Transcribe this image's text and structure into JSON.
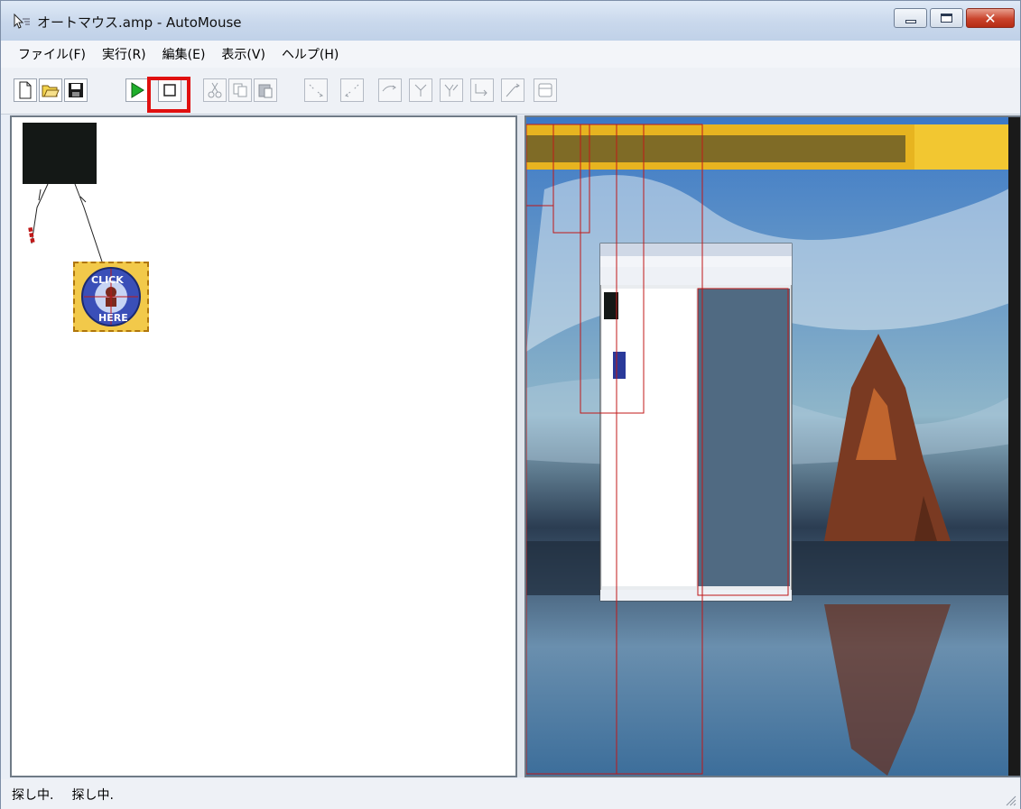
{
  "window": {
    "title": "オートマウス.amp - AutoMouse",
    "controls": [
      "minimize-icon",
      "maximize-icon",
      "close-icon"
    ]
  },
  "menu": {
    "items": [
      "ファイル(F)",
      "実行(R)",
      "編集(E)",
      "表示(V)",
      "ヘルプ(H)"
    ]
  },
  "toolbar": {
    "buttons": [
      {
        "icon": "new-file-icon",
        "enabled": true
      },
      {
        "icon": "open-folder-icon",
        "enabled": true
      },
      {
        "icon": "save-icon",
        "enabled": true
      },
      {
        "icon": "run-icon",
        "enabled": true
      },
      {
        "icon": "stop-icon",
        "enabled": true,
        "highlighted": true
      },
      {
        "icon": "cut-icon",
        "enabled": false
      },
      {
        "icon": "copy-icon",
        "enabled": false
      },
      {
        "icon": "paste-icon",
        "enabled": false
      },
      {
        "icon": "step-in-icon",
        "enabled": false
      },
      {
        "icon": "step-out-icon",
        "enabled": false
      },
      {
        "icon": "branch-1-icon",
        "enabled": false
      },
      {
        "icon": "branch-2-icon",
        "enabled": false
      },
      {
        "icon": "branch-3-icon",
        "enabled": false
      },
      {
        "icon": "branch-4-icon",
        "enabled": false
      },
      {
        "icon": "branch-5-icon",
        "enabled": false
      },
      {
        "icon": "window-icon",
        "enabled": false
      }
    ]
  },
  "canvas": {
    "nodes": [
      {
        "name": "black-box-node"
      },
      {
        "name": "click-here-node",
        "label_top": "CLICK",
        "label_bottom": "HERE"
      }
    ]
  },
  "status": {
    "left": "探し中.",
    "right": "探し中."
  },
  "colors": {
    "highlight": "#e01010",
    "run_green": "#1fae2b",
    "link_red": "#c01818"
  }
}
